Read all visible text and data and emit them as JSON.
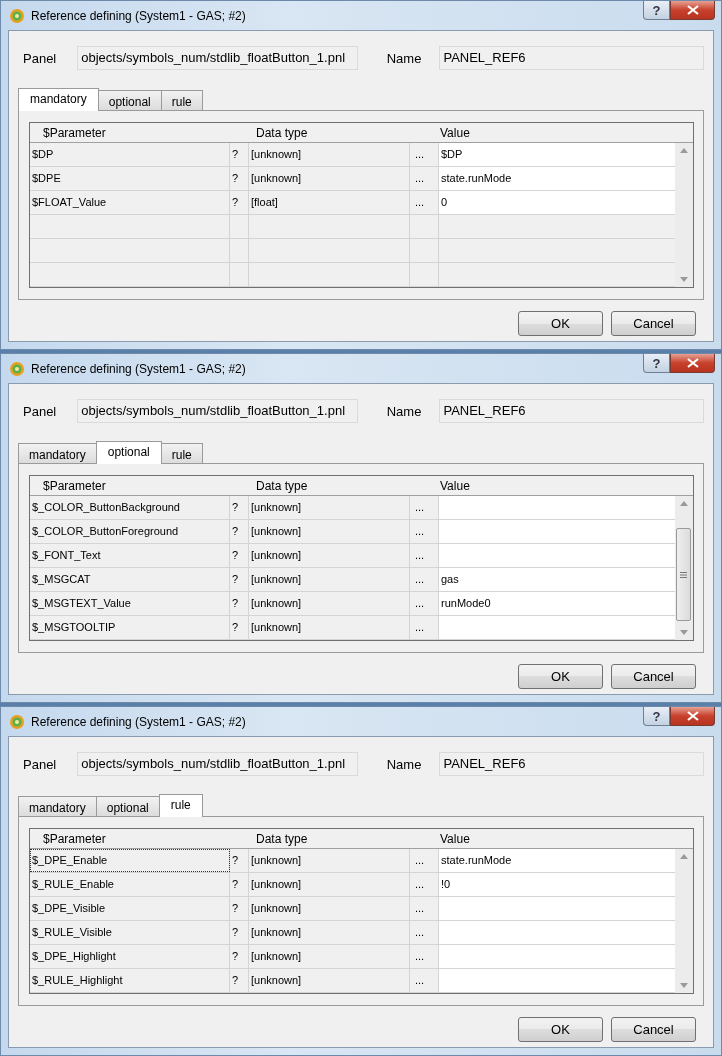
{
  "windows": [
    {
      "title": "Reference defining (System1 - GAS; #2)",
      "help_button": "?",
      "panel_label": "Panel",
      "panel_value": "objects/symbols_num/stdlib_floatButton_1.pnl",
      "name_label": "Name",
      "name_value": "PANEL_REF6",
      "tabs": [
        {
          "label": "mandatory",
          "selected": true
        },
        {
          "label": "optional",
          "selected": false
        },
        {
          "label": "rule",
          "selected": false
        }
      ],
      "table": {
        "columns": [
          "$Parameter",
          "Data type",
          "Value"
        ],
        "scroll_thumb": false,
        "rows": [
          {
            "parameter": "$DP",
            "help": "?",
            "data_type": "[unknown]",
            "browse": "...",
            "value": "$DP",
            "focused": false
          },
          {
            "parameter": "$DPE",
            "help": "?",
            "data_type": "[unknown]",
            "browse": "...",
            "value": "state.runMode",
            "focused": false
          },
          {
            "parameter": "$FLOAT_Value",
            "help": "?",
            "data_type": "[float]",
            "browse": "...",
            "value": "0",
            "focused": false
          }
        ]
      },
      "buttons": [
        "OK",
        "Cancel"
      ]
    },
    {
      "title": "Reference defining (System1 - GAS; #2)",
      "help_button": "?",
      "panel_label": "Panel",
      "panel_value": "objects/symbols_num/stdlib_floatButton_1.pnl",
      "name_label": "Name",
      "name_value": "PANEL_REF6",
      "tabs": [
        {
          "label": "mandatory",
          "selected": false
        },
        {
          "label": "optional",
          "selected": true
        },
        {
          "label": "rule",
          "selected": false
        }
      ],
      "table": {
        "columns": [
          "$Parameter",
          "Data type",
          "Value"
        ],
        "scroll_thumb": true,
        "rows": [
          {
            "parameter": "$_COLOR_ButtonBackground",
            "help": "?",
            "data_type": "[unknown]",
            "browse": "...",
            "value": "",
            "focused": false
          },
          {
            "parameter": "$_COLOR_ButtonForeground",
            "help": "?",
            "data_type": "[unknown]",
            "browse": "...",
            "value": "",
            "focused": false
          },
          {
            "parameter": "$_FONT_Text",
            "help": "?",
            "data_type": "[unknown]",
            "browse": "...",
            "value": "",
            "focused": false
          },
          {
            "parameter": "$_MSGCAT",
            "help": "?",
            "data_type": "[unknown]",
            "browse": "...",
            "value": "gas",
            "focused": false
          },
          {
            "parameter": "$_MSGTEXT_Value",
            "help": "?",
            "data_type": "[unknown]",
            "browse": "...",
            "value": "runMode0",
            "focused": false
          },
          {
            "parameter": "$_MSGTOOLTIP",
            "help": "?",
            "data_type": "[unknown]",
            "browse": "...",
            "value": "",
            "focused": false
          }
        ]
      },
      "buttons": [
        "OK",
        "Cancel"
      ]
    },
    {
      "title": "Reference defining (System1 - GAS; #2)",
      "help_button": "?",
      "panel_label": "Panel",
      "panel_value": "objects/symbols_num/stdlib_floatButton_1.pnl",
      "name_label": "Name",
      "name_value": "PANEL_REF6",
      "tabs": [
        {
          "label": "mandatory",
          "selected": false
        },
        {
          "label": "optional",
          "selected": false
        },
        {
          "label": "rule",
          "selected": true
        }
      ],
      "table": {
        "columns": [
          "$Parameter",
          "Data type",
          "Value"
        ],
        "scroll_thumb": false,
        "rows": [
          {
            "parameter": "$_DPE_Enable",
            "help": "?",
            "data_type": "[unknown]",
            "browse": "...",
            "value": "state.runMode",
            "focused": true
          },
          {
            "parameter": "$_RULE_Enable",
            "help": "?",
            "data_type": "[unknown]",
            "browse": "...",
            "value": "!0",
            "focused": false
          },
          {
            "parameter": "$_DPE_Visible",
            "help": "?",
            "data_type": "[unknown]",
            "browse": "...",
            "value": "",
            "focused": false
          },
          {
            "parameter": "$_RULE_Visible",
            "help": "?",
            "data_type": "[unknown]",
            "browse": "...",
            "value": "",
            "focused": false
          },
          {
            "parameter": "$_DPE_Highlight",
            "help": "?",
            "data_type": "[unknown]",
            "browse": "...",
            "value": "",
            "focused": false
          },
          {
            "parameter": "$_RULE_Highlight",
            "help": "?",
            "data_type": "[unknown]",
            "browse": "...",
            "value": "",
            "focused": false
          }
        ]
      },
      "buttons": [
        "OK",
        "Cancel"
      ]
    }
  ]
}
